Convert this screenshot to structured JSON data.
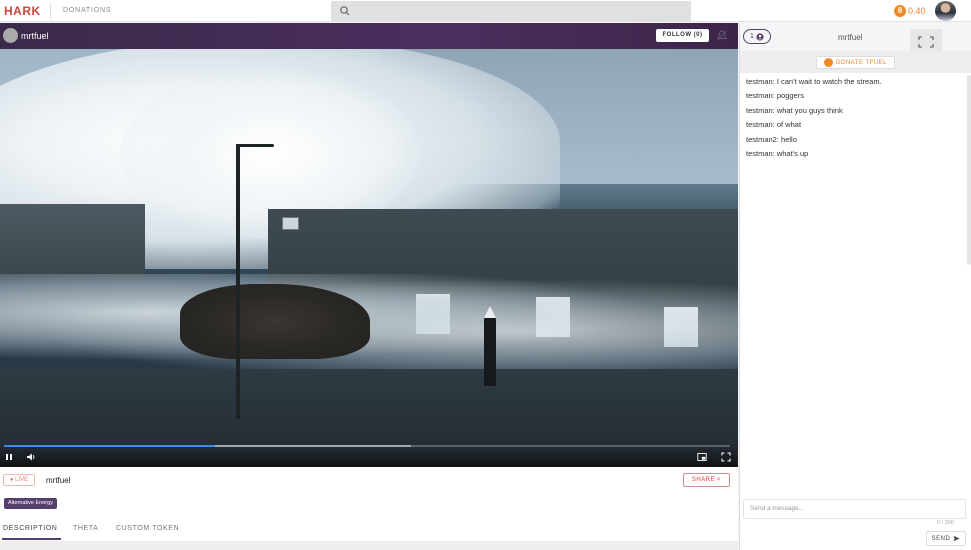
{
  "nav": {
    "logo": "HARK",
    "donations_link": "DONATIONS",
    "search_icon": "search-icon",
    "balance_coin": "θ",
    "balance_value": "0.40"
  },
  "stream": {
    "streamer_name": "mrtfuel",
    "follow_label": "FOLLOW (0)",
    "bell_icon": "bell-icon"
  },
  "player": {
    "progress_fraction": 0.29,
    "buffer_fraction": 0.56,
    "controls": [
      "pause-icon",
      "volume-icon",
      "picture-in-picture-icon",
      "fullscreen-icon"
    ]
  },
  "info": {
    "live_label": "● LIVE",
    "name": "mrtfuel",
    "share_label": "SHARE <",
    "tag": "Alternative Energy",
    "tabs": [
      "DESCRIPTION",
      "THETA",
      "CUSTOM TOKEN"
    ]
  },
  "chat": {
    "viewer_count": "1",
    "title": "mrtfuel",
    "donate_label": "DONATE TFUEL",
    "messages": [
      "testman: I can't wait to watch the stream.",
      "testman: poggers",
      "testman: what you guys think",
      "testman: of what",
      "testman2: hello",
      "testman: what's up"
    ],
    "input_placeholder": "Send a message...",
    "char_count": "0 / 300",
    "send_label": "SEND"
  },
  "colors": {
    "brand": "#c7493d",
    "accent_purple": "#563f6c",
    "coin_orange": "#f08a24",
    "progress_blue": "#3b8ee8"
  }
}
